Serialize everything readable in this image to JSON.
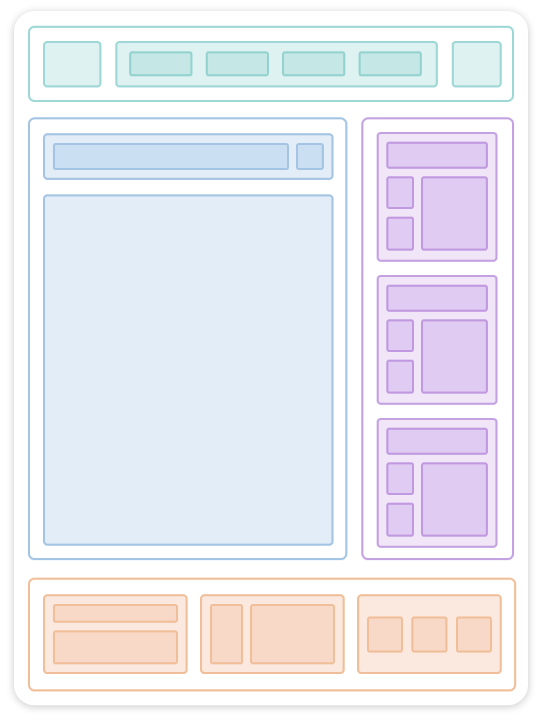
{
  "palette": {
    "header": "#9dd8d7",
    "main": "#a4c4e4",
    "sidebar": "#c4a2e2",
    "footer": "#f0bf9a"
  },
  "header": {
    "nav_item_count": 4
  },
  "sidebar": {
    "card_count": 3
  },
  "footer": {
    "group_count": 3
  }
}
